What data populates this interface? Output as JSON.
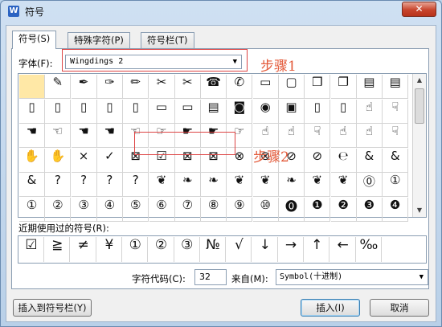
{
  "window": {
    "app_icon": "W",
    "title": "符号",
    "close": "✕"
  },
  "tabs": [
    "符号(S)",
    "特殊字符(P)",
    "符号栏(T)"
  ],
  "font": {
    "label": "字体(F):",
    "value": "Wingdings 2",
    "arrow": "▼"
  },
  "annotations": {
    "step1": "步骤1",
    "step2": "步骤2"
  },
  "symbol_grid": [
    [
      "",
      "✎",
      "✒",
      "✑",
      "✏",
      "✂",
      "✂",
      "☎",
      "✆",
      "▭",
      "▢",
      "❒",
      "❐",
      "▤",
      "▤"
    ],
    [
      "▯",
      "▯",
      "▯",
      "▯",
      "▯",
      "▭",
      "▭",
      "▤",
      "◙",
      "◉",
      "▣",
      "▯",
      "▯",
      "☝",
      "☟"
    ],
    [
      "☚",
      "☜",
      "☚",
      "☚",
      "☜",
      "☞",
      "☛",
      "☛",
      "☞",
      "☝",
      "☝",
      "☟",
      "☝",
      "☝",
      "☟"
    ],
    [
      "✋",
      "✋",
      "×",
      "✓",
      "⊠",
      "☑",
      "⊠",
      "⊠",
      "⊗",
      "⊗",
      "⊘",
      "⊘",
      "℮",
      "&",
      "&"
    ],
    [
      "&",
      "?",
      "?",
      "?",
      "?",
      "❦",
      "❧",
      "❧",
      "❦",
      "❦",
      "❧",
      "❦",
      "❦",
      "⓪",
      "①"
    ],
    [
      "①",
      "②",
      "③",
      "④",
      "⑤",
      "⑥",
      "⑦",
      "⑧",
      "⑨",
      "⑩",
      "⓿",
      "❶",
      "❷",
      "❸",
      "❹"
    ]
  ],
  "recent": {
    "label": "近期使用过的符号(R):",
    "symbols": [
      "☑",
      "≧",
      "≠",
      "¥",
      "①",
      "②",
      "③",
      "№",
      "√",
      "↓",
      "→",
      "↑",
      "←",
      "‰"
    ]
  },
  "char_code": {
    "label": "字符代码(C):",
    "value": "32"
  },
  "from": {
    "label": "来自(M):",
    "value": "Symbol(十进制)",
    "arrow": "▼"
  },
  "buttons": {
    "insert_to_bar": "插入到符号栏(Y)",
    "insert": "插入(I)",
    "cancel": "取消"
  }
}
